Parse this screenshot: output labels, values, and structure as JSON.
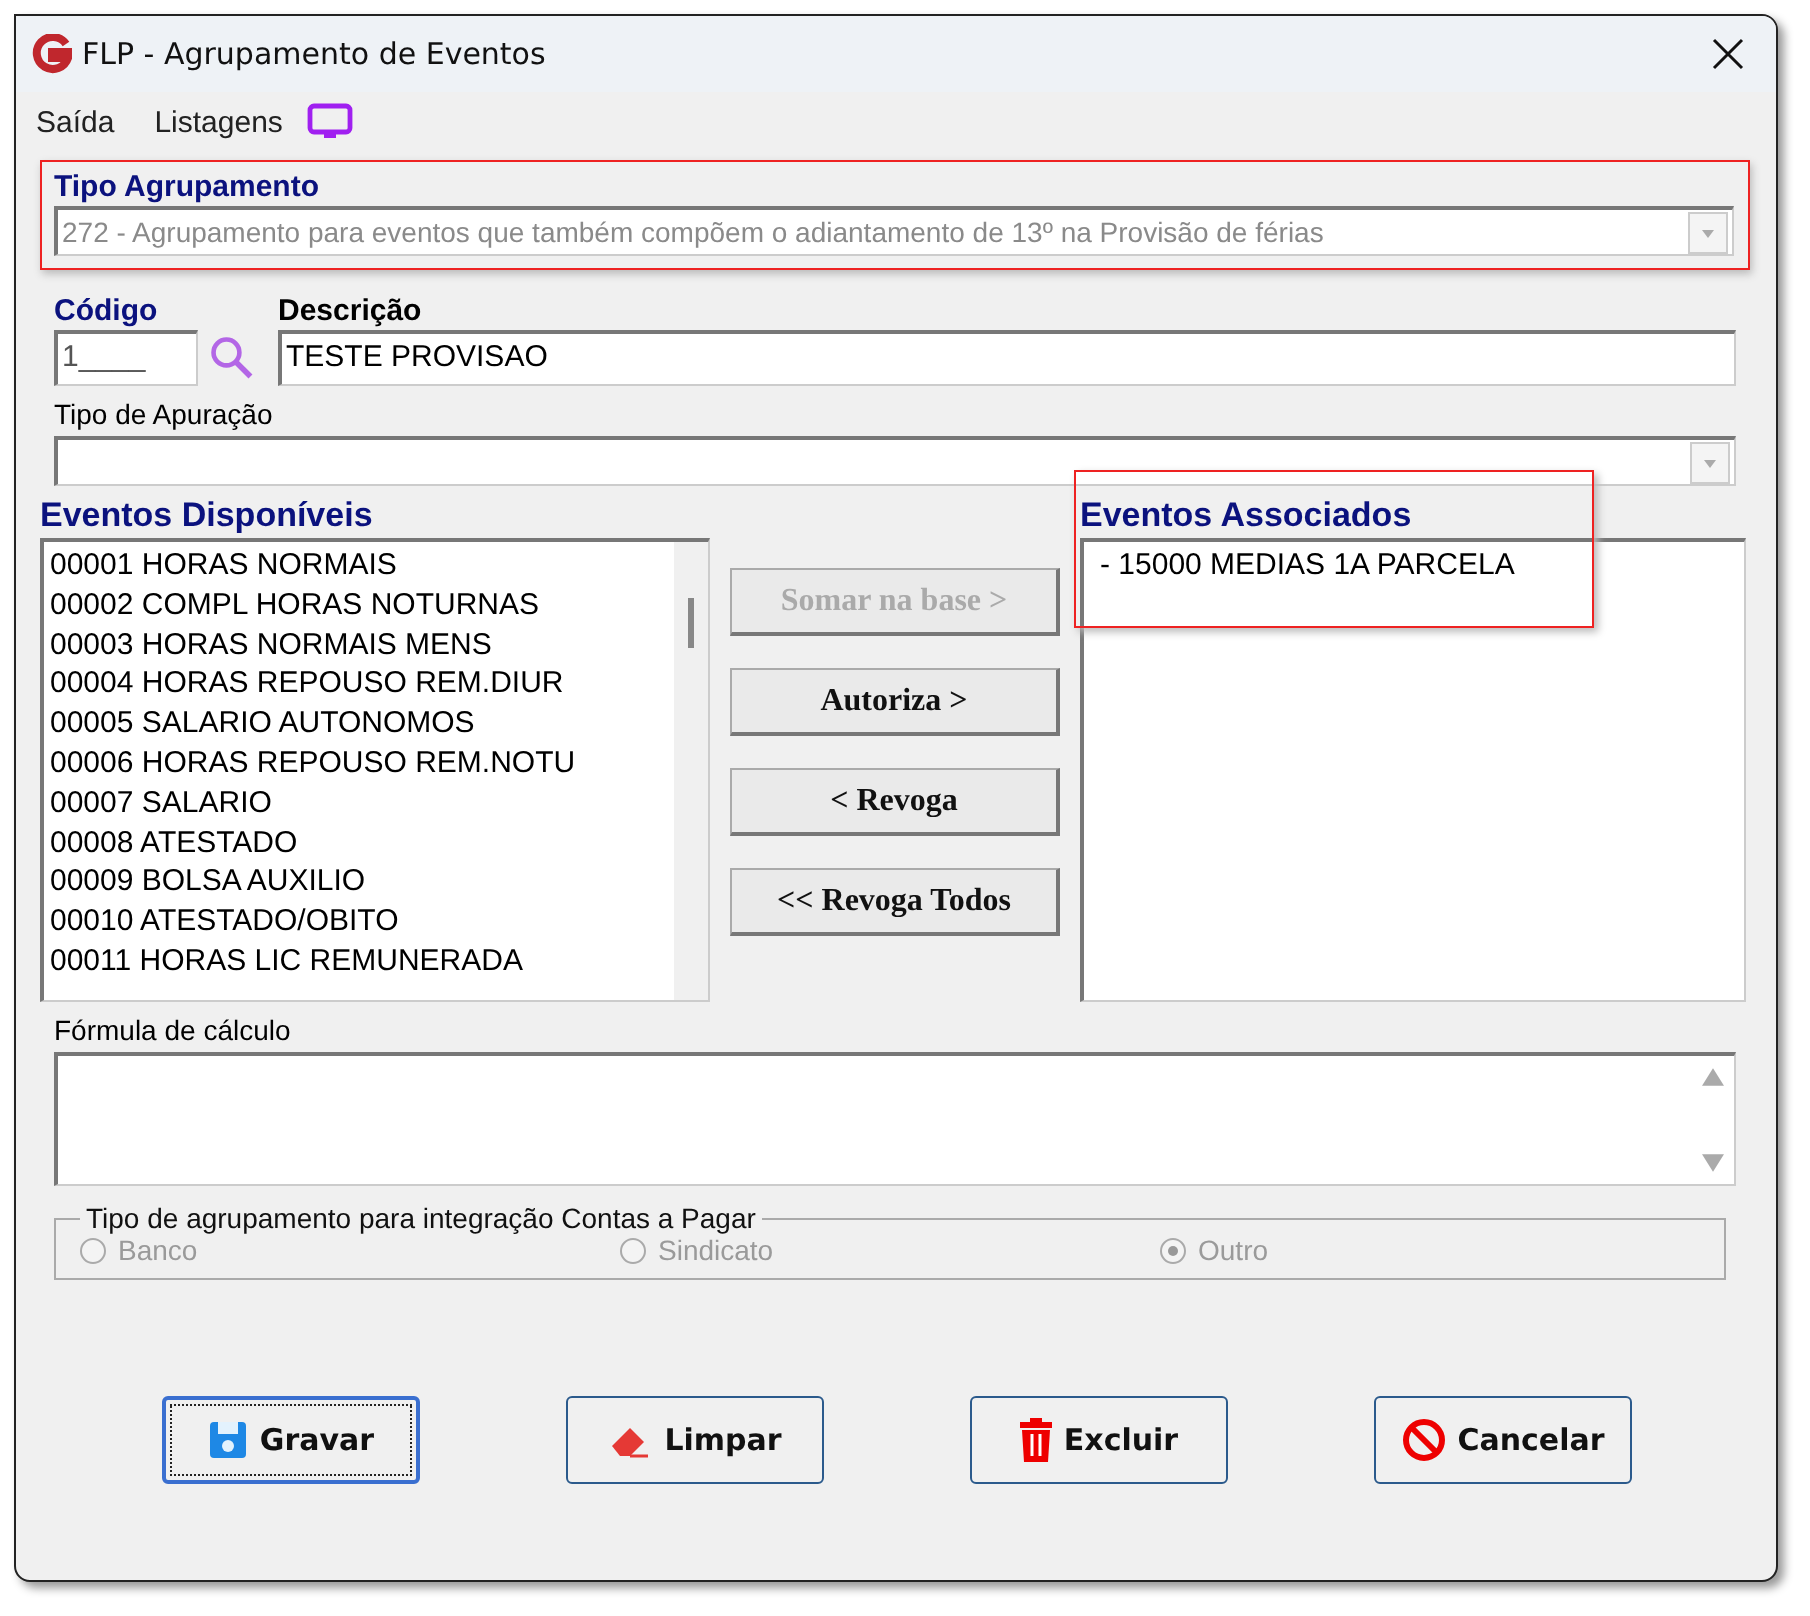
{
  "window": {
    "title": "FLP - Agrupamento de Eventos"
  },
  "menu": [
    "Saída",
    "Listagens"
  ],
  "tipo_agrupamento": {
    "label": "Tipo Agrupamento",
    "value": "272 - Agrupamento para eventos que também compõem o adiantamento de 13º na Provisão de férias",
    "highlighted": true
  },
  "codigo": {
    "label": "Código",
    "value": "1____"
  },
  "descricao": {
    "label": "Descrição",
    "value": "TESTE PROVISAO"
  },
  "tipo_apuracao": {
    "label": "Tipo de Apuração"
  },
  "eventos_disponiveis": {
    "title": "Eventos Disponíveis",
    "items": [
      "00001 HORAS NORMAIS",
      "00002 COMPL HORAS NOTURNAS",
      "00003 HORAS NORMAIS MENS",
      "00004 HORAS REPOUSO REM.DIUR",
      "00005 SALARIO AUTONOMOS",
      "00006 HORAS REPOUSO REM.NOTU",
      "00007 SALARIO",
      "00008 ATESTADO",
      "00009 BOLSA AUXILIO",
      "00010 ATESTADO/OBITO",
      "00011 HORAS LIC REMUNERADA"
    ]
  },
  "transfer_buttons": [
    {
      "label": "Somar  na base >",
      "disabled": true
    },
    {
      "label": "Autoriza >",
      "disabled": false
    },
    {
      "label": "< Revoga",
      "disabled": false
    },
    {
      "label": "<< Revoga Todos",
      "disabled": false
    }
  ],
  "eventos_associados": {
    "title": "Eventos Associados",
    "items": [
      "- 15000 MEDIAS 1A PARCELA"
    ],
    "highlighted": true
  },
  "formula": {
    "label": "Fórmula de cálculo"
  },
  "contas_a_pagar": {
    "title": "Tipo de agrupamento para integração Contas a Pagar",
    "options": [
      {
        "label": "Banco",
        "selected": false,
        "disabled": true
      },
      {
        "label": "Sindicato",
        "selected": false,
        "disabled": true
      },
      {
        "label": "Outro",
        "selected": true,
        "disabled": true
      }
    ]
  },
  "buttons": [
    {
      "label": "Gravar",
      "kind": "save",
      "focused": true
    },
    {
      "label": "Limpar",
      "kind": "clear",
      "focused": false
    },
    {
      "label": "Excluir",
      "kind": "delete",
      "focused": false
    },
    {
      "label": "Cancelar",
      "kind": "cancel",
      "focused": false
    }
  ]
}
